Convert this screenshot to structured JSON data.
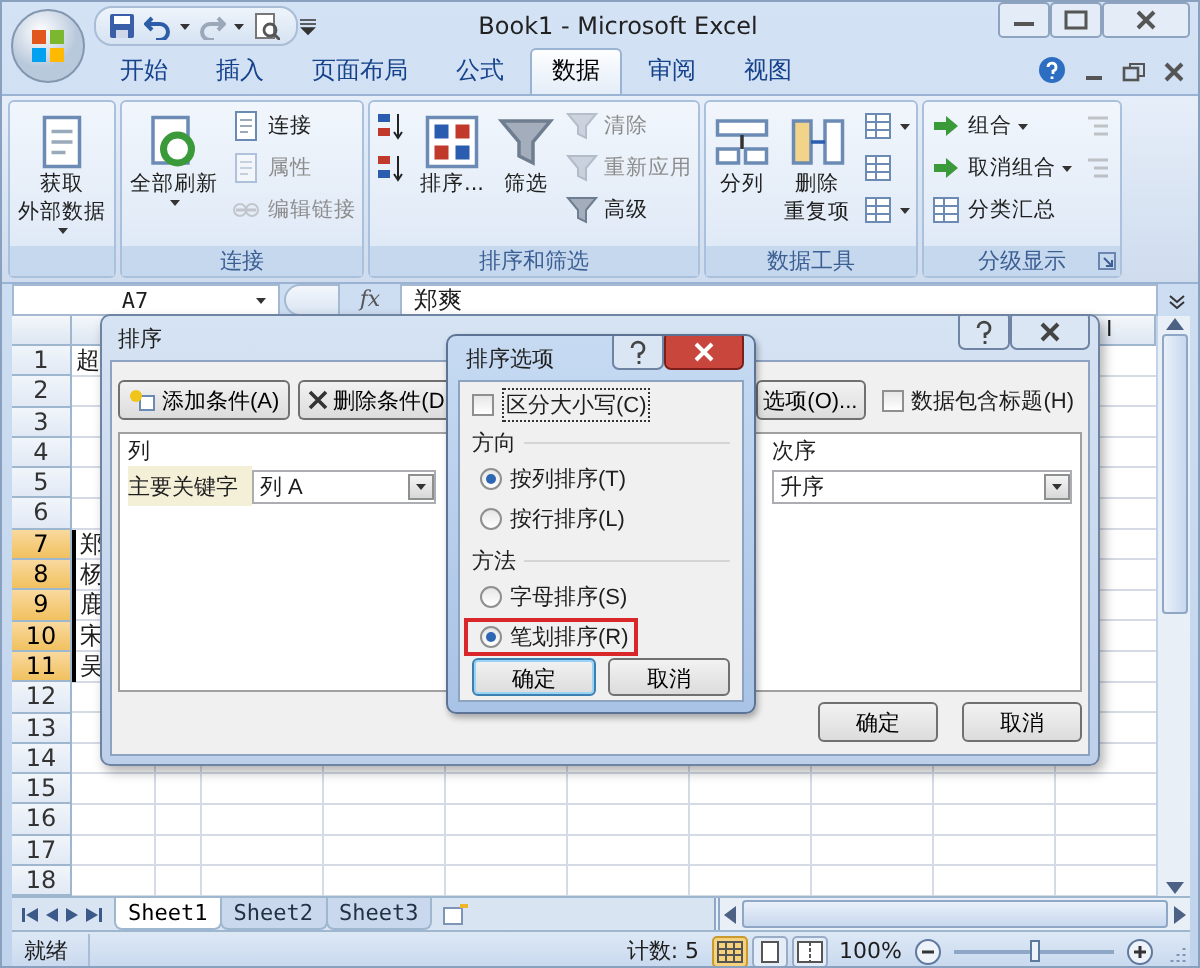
{
  "window": {
    "title": "Book1 - Microsoft Excel"
  },
  "ribbon": {
    "tabs": [
      {
        "label": "开始",
        "selected": false
      },
      {
        "label": "插入",
        "selected": false
      },
      {
        "label": "页面布局",
        "selected": false
      },
      {
        "label": "公式",
        "selected": false
      },
      {
        "label": "数据",
        "selected": true
      },
      {
        "label": "审阅",
        "selected": false
      },
      {
        "label": "视图",
        "selected": false
      }
    ],
    "groups": [
      {
        "items": [
          {
            "kind": "large",
            "lines": [
              "获取",
              "外部数据"
            ],
            "dropdown": true,
            "disabled": false
          }
        ]
      },
      {
        "label": "连接",
        "items": [
          {
            "kind": "large",
            "lines": [
              "全部刷新"
            ],
            "dropdown": true,
            "disabled": false
          },
          {
            "kind": "small",
            "label": "连接",
            "dropdown": false,
            "disabled": false
          },
          {
            "kind": "small",
            "label": "属性",
            "dropdown": false,
            "disabled": true
          },
          {
            "kind": "small",
            "label": "编辑链接",
            "dropdown": false,
            "disabled": true
          }
        ]
      },
      {
        "label": "排序和筛选",
        "items": [
          {
            "kind": "icon",
            "dropdown": false,
            "disabled": false
          },
          {
            "kind": "icon",
            "dropdown": false,
            "disabled": false
          },
          {
            "kind": "large",
            "lines": [
              "排序..."
            ],
            "dropdown": false,
            "disabled": false
          },
          {
            "kind": "large",
            "lines": [
              "筛选"
            ],
            "dropdown": false,
            "disabled": false
          },
          {
            "kind": "small",
            "label": "清除",
            "dropdown": false,
            "disabled": true
          },
          {
            "kind": "small",
            "label": "重新应用",
            "dropdown": false,
            "disabled": true
          },
          {
            "kind": "small",
            "label": "高级",
            "dropdown": false,
            "disabled": false
          }
        ]
      },
      {
        "label": "数据工具",
        "items": [
          {
            "kind": "large",
            "lines": [
              "分列"
            ],
            "dropdown": false,
            "disabled": false
          },
          {
            "kind": "large",
            "lines": [
              "删除",
              "重复项"
            ],
            "dropdown": false,
            "disabled": false
          },
          {
            "kind": "icon",
            "dropdown": true,
            "disabled": false
          },
          {
            "kind": "icon",
            "dropdown": false,
            "disabled": false
          },
          {
            "kind": "icon",
            "dropdown": true,
            "disabled": false
          }
        ]
      },
      {
        "label": "分级显示",
        "dialog_launcher": true,
        "items": [
          {
            "kind": "small",
            "label": "组合",
            "dropdown": true,
            "disabled": false
          },
          {
            "kind": "small",
            "label": "取消组合",
            "dropdown": true,
            "disabled": false
          },
          {
            "kind": "small",
            "label": "分类汇总",
            "dropdown": false,
            "disabled": false
          },
          {
            "kind": "icon",
            "dropdown": false,
            "disabled": true
          },
          {
            "kind": "icon",
            "dropdown": false,
            "disabled": true
          }
        ]
      }
    ]
  },
  "formula_bar": {
    "name_box": "A7",
    "function_label": "fx",
    "value": "郑爽"
  },
  "sheet": {
    "visible_column_header": "I",
    "rows": [
      {
        "number": "1",
        "text": "超",
        "selected": false
      },
      {
        "number": "2",
        "selected": false
      },
      {
        "number": "3",
        "selected": false
      },
      {
        "number": "4",
        "selected": false
      },
      {
        "number": "5",
        "selected": false
      },
      {
        "number": "6",
        "selected": false
      },
      {
        "number": "7",
        "text": "郑",
        "selected": true
      },
      {
        "number": "8",
        "text": "杨",
        "selected": true
      },
      {
        "number": "9",
        "text": "鹿",
        "selected": true
      },
      {
        "number": "10",
        "text": "宋",
        "selected": true
      },
      {
        "number": "11",
        "text": "吴",
        "selected": true
      },
      {
        "number": "12",
        "selected": false
      },
      {
        "number": "13",
        "selected": false
      },
      {
        "number": "14",
        "selected": false
      },
      {
        "number": "15",
        "selected": false
      },
      {
        "number": "16",
        "selected": false
      },
      {
        "number": "17",
        "selected": false
      },
      {
        "number": "18",
        "selected": false
      }
    ]
  },
  "sheet_tabs": [
    {
      "label": "Sheet1",
      "selected": true
    },
    {
      "label": "Sheet2",
      "selected": false
    },
    {
      "label": "Sheet3",
      "selected": false
    }
  ],
  "status_bar": {
    "ready": "就绪",
    "count": "计数: 5",
    "views": [
      {
        "selected": true
      },
      {
        "selected": false
      },
      {
        "selected": false
      }
    ],
    "zoom": "100%",
    "zoom_slider": {
      "level": 0.5
    }
  },
  "sort_dialog": {
    "title": "排序",
    "toolbar": [
      "添加条件(A)",
      "删除条件(D",
      "选项(O)..."
    ],
    "header_checkbox": {
      "label": "数据包含标题(H)",
      "checked": false
    },
    "columns": [
      "列",
      "次序"
    ],
    "rows": [
      {
        "key": "主要关键字",
        "column": "列 A",
        "order": "升序"
      }
    ],
    "buttons": [
      "确定",
      "取消"
    ]
  },
  "options_dialog": {
    "title": "排序选项",
    "case_sensitive": {
      "label": "区分大小写(C)",
      "checked": false
    },
    "sections": [
      {
        "title": "方向",
        "options": [
          {
            "label": "按列排序(T)",
            "selected": true,
            "highlighted": false
          },
          {
            "label": "按行排序(L)",
            "selected": false,
            "highlighted": false
          }
        ]
      },
      {
        "title": "方法",
        "options": [
          {
            "label": "字母排序(S)",
            "selected": false,
            "highlighted": false
          },
          {
            "label": "笔划排序(R)",
            "selected": true,
            "highlighted": true
          }
        ]
      }
    ],
    "buttons": [
      "确定",
      "取消"
    ]
  }
}
